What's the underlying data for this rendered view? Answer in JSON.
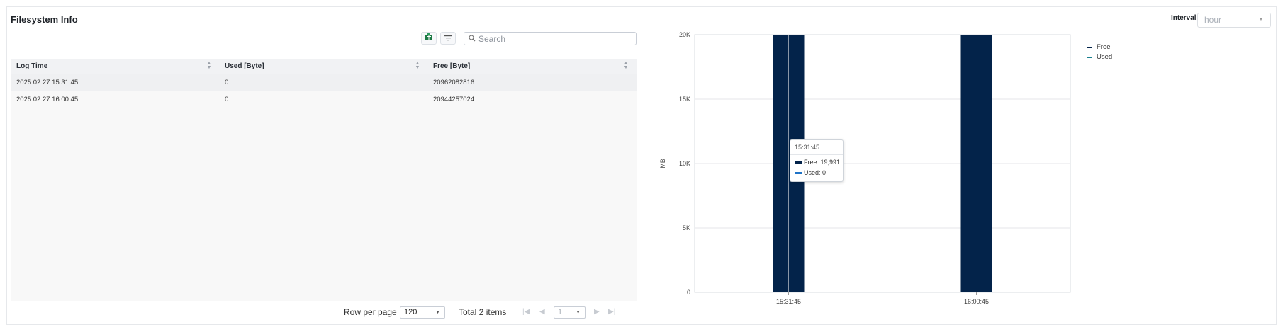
{
  "title": "Filesystem Info",
  "interval": {
    "label": "Interval",
    "value": "hour"
  },
  "toolbar": {
    "excel_icon": "excel-export-icon",
    "filter_icon": "filter-icon"
  },
  "search": {
    "placeholder": "Search",
    "value": ""
  },
  "table": {
    "headers": [
      "Log Time",
      "Used [Byte]",
      "Free [Byte]"
    ],
    "rows": [
      [
        "2025.02.27 15:31:45",
        "0",
        "20962082816"
      ],
      [
        "2025.02.27 16:00:45",
        "0",
        "20944257024"
      ]
    ]
  },
  "pager": {
    "rows_label": "Row per page",
    "rows_value": "120",
    "total": "Total 2 items",
    "page": "1"
  },
  "legend": [
    {
      "name": "Free",
      "color": "#03234a"
    },
    {
      "name": "Used",
      "color": "#1f73c7"
    }
  ],
  "tooltip": {
    "time": "15:31:45",
    "free": "Free: 19,991",
    "used": "Used: 0"
  },
  "chart_data": {
    "type": "bar",
    "categories": [
      "15:31:45",
      "16:00:45"
    ],
    "series": [
      {
        "name": "Free",
        "values": [
          19991,
          19974
        ],
        "color": "#03234a"
      },
      {
        "name": "Used",
        "values": [
          0,
          0
        ],
        "color": "#1f73c7"
      }
    ],
    "ylabel": "MB",
    "ylim": [
      0,
      20000
    ],
    "yticks": [
      0,
      5000,
      10000,
      15000,
      20000
    ],
    "ytick_labels": [
      "0",
      "5K",
      "10K",
      "15K",
      "20K"
    ],
    "grid": true,
    "legend": "top-right"
  }
}
